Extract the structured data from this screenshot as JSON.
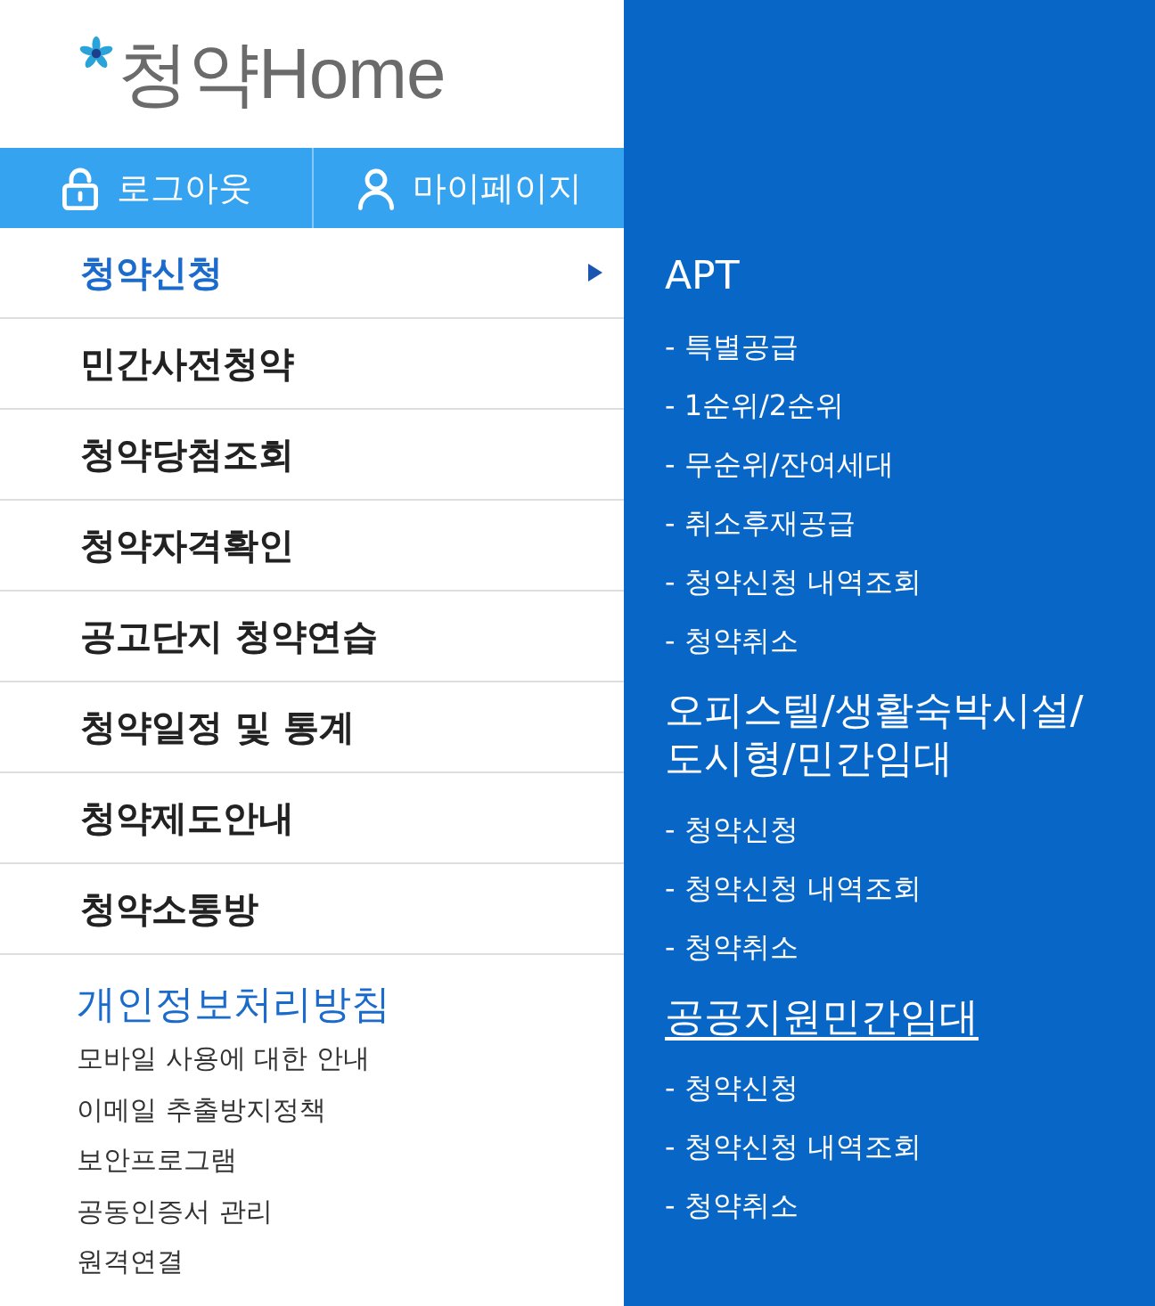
{
  "logo": {
    "text": "청약Home"
  },
  "account_buttons": [
    {
      "kind": "logout",
      "label": "로그아웃"
    },
    {
      "kind": "mypage",
      "label": "마이페이지"
    }
  ],
  "menu": [
    {
      "label": "청약신청",
      "selected": true
    },
    {
      "label": "민간사전청약",
      "selected": false
    },
    {
      "label": "청약당첨조회",
      "selected": false
    },
    {
      "label": "청약자격확인",
      "selected": false
    },
    {
      "label": "공고단지 청약연습",
      "selected": false
    },
    {
      "label": "청약일정 및 통계",
      "selected": false
    },
    {
      "label": "청약제도안내",
      "selected": false
    },
    {
      "label": "청약소통방",
      "selected": false
    }
  ],
  "policy": {
    "title": "개인정보처리방침",
    "links": [
      "모바일 사용에 대한 안내",
      "이메일 추출방지정책",
      "보안프로그램",
      "공동인증서 관리",
      "원격연결"
    ]
  },
  "submenu": {
    "groups": [
      {
        "title": "APT",
        "hovered": false,
        "items": [
          "- 특별공급",
          "- 1순위/2순위",
          "- 무순위/잔여세대",
          "- 취소후재공급",
          "- 청약신청 내역조회",
          "- 청약취소"
        ]
      },
      {
        "title": "오피스텔/생활숙박시설/도시형/민간임대",
        "hovered": false,
        "items": [
          "- 청약신청",
          "- 청약신청 내역조회",
          "- 청약취소"
        ]
      },
      {
        "title": "공공지원민간임대",
        "hovered": true,
        "items": [
          "- 청약신청",
          "- 청약신청 내역조회",
          "- 청약취소"
        ]
      }
    ]
  }
}
